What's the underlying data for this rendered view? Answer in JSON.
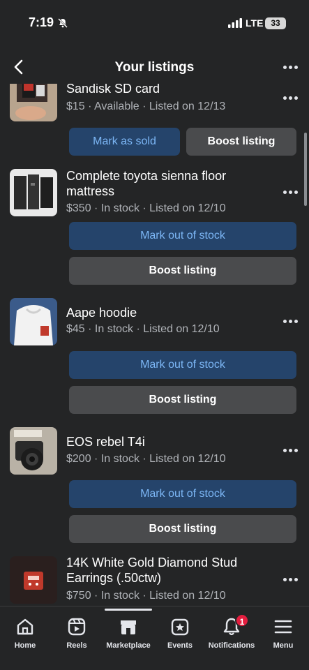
{
  "status_bar": {
    "time": "7:19",
    "network": "LTE",
    "battery": "33"
  },
  "header": {
    "title": "Your listings"
  },
  "listings": [
    {
      "title": "Sandisk SD card",
      "meta": "$15 · Available · Listed on 12/13",
      "primary_action": "Mark as sold",
      "secondary_action": "Boost listing"
    },
    {
      "title": "Complete toyota sienna floor mattress",
      "meta": "$350 · In stock · Listed on 12/10",
      "primary_action": "Mark out of stock",
      "secondary_action": "Boost listing"
    },
    {
      "title": "Aape hoodie",
      "meta": "$45 · In stock · Listed on 12/10",
      "primary_action": "Mark out of stock",
      "secondary_action": "Boost listing"
    },
    {
      "title": "EOS rebel T4i",
      "meta": "$200 · In stock · Listed on 12/10",
      "primary_action": "Mark out of stock",
      "secondary_action": "Boost listing"
    },
    {
      "title": "14K White Gold Diamond Stud Earrings (.50ctw)",
      "meta": "$750 · In stock · Listed on 12/10"
    }
  ],
  "tabbar": {
    "tabs": [
      {
        "label": "Home",
        "icon": "home-icon"
      },
      {
        "label": "Reels",
        "icon": "reels-icon"
      },
      {
        "label": "Marketplace",
        "icon": "marketplace-icon",
        "active": true
      },
      {
        "label": "Events",
        "icon": "events-icon"
      },
      {
        "label": "Notifications",
        "icon": "bell-icon",
        "badge": "1"
      },
      {
        "label": "Menu",
        "icon": "menu-icon"
      }
    ]
  },
  "colors": {
    "background": "#242526",
    "primary_button": "#25446b",
    "primary_button_text": "#7cb6f5",
    "secondary_button": "#4a4b4d",
    "badge": "#e41e3f"
  }
}
